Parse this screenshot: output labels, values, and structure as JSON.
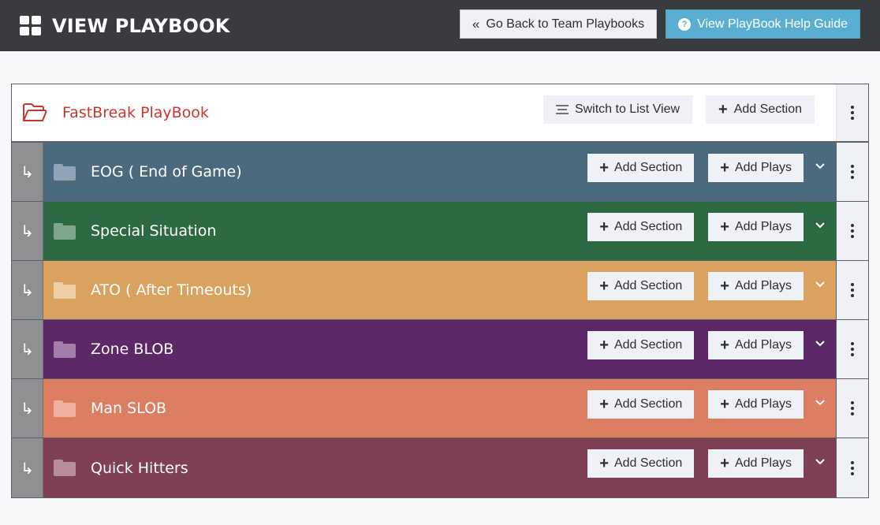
{
  "header": {
    "title": "VIEW PLAYBOOK",
    "icon": "grid-icon",
    "back_button": {
      "label": "Go Back to Team Playbooks",
      "icon": "double-chevron-left-icon"
    },
    "help_button": {
      "label": "View PlayBook Help Guide",
      "icon": "question-circle-icon"
    }
  },
  "playbook": {
    "title": "FastBreak PlayBook",
    "icon": "folder-open-icon",
    "title_color": "#c9372c",
    "switch_view_label": "Switch to List View",
    "add_section_label": "Add Section"
  },
  "sections": [
    {
      "title": "EOG ( End of Game)",
      "color": "#4b6a7e",
      "folder_color": "#8fa5b3",
      "add_section_label": "Add Section",
      "add_plays_label": "Add Plays"
    },
    {
      "title": "Special Situation",
      "color": "#2e6a41",
      "folder_color": "#7fa68a",
      "add_section_label": "Add Section",
      "add_plays_label": "Add Plays"
    },
    {
      "title": "ATO ( After Timeouts)",
      "color": "#d9a35f",
      "folder_color": "#f0cfa6",
      "add_section_label": "Add Section",
      "add_plays_label": "Add Plays"
    },
    {
      "title": "Zone BLOB",
      "color": "#5d2868",
      "folder_color": "#a47ea9",
      "add_section_label": "Add Section",
      "add_plays_label": "Add Plays"
    },
    {
      "title": "Man SLOB",
      "color": "#dc7e62",
      "folder_color": "#edb19f",
      "add_section_label": "Add Section",
      "add_plays_label": "Add Plays"
    },
    {
      "title": "Quick Hitters",
      "color": "#7f4056",
      "folder_color": "#b88d9c",
      "add_section_label": "Add Section",
      "add_plays_label": "Add Plays"
    }
  ]
}
